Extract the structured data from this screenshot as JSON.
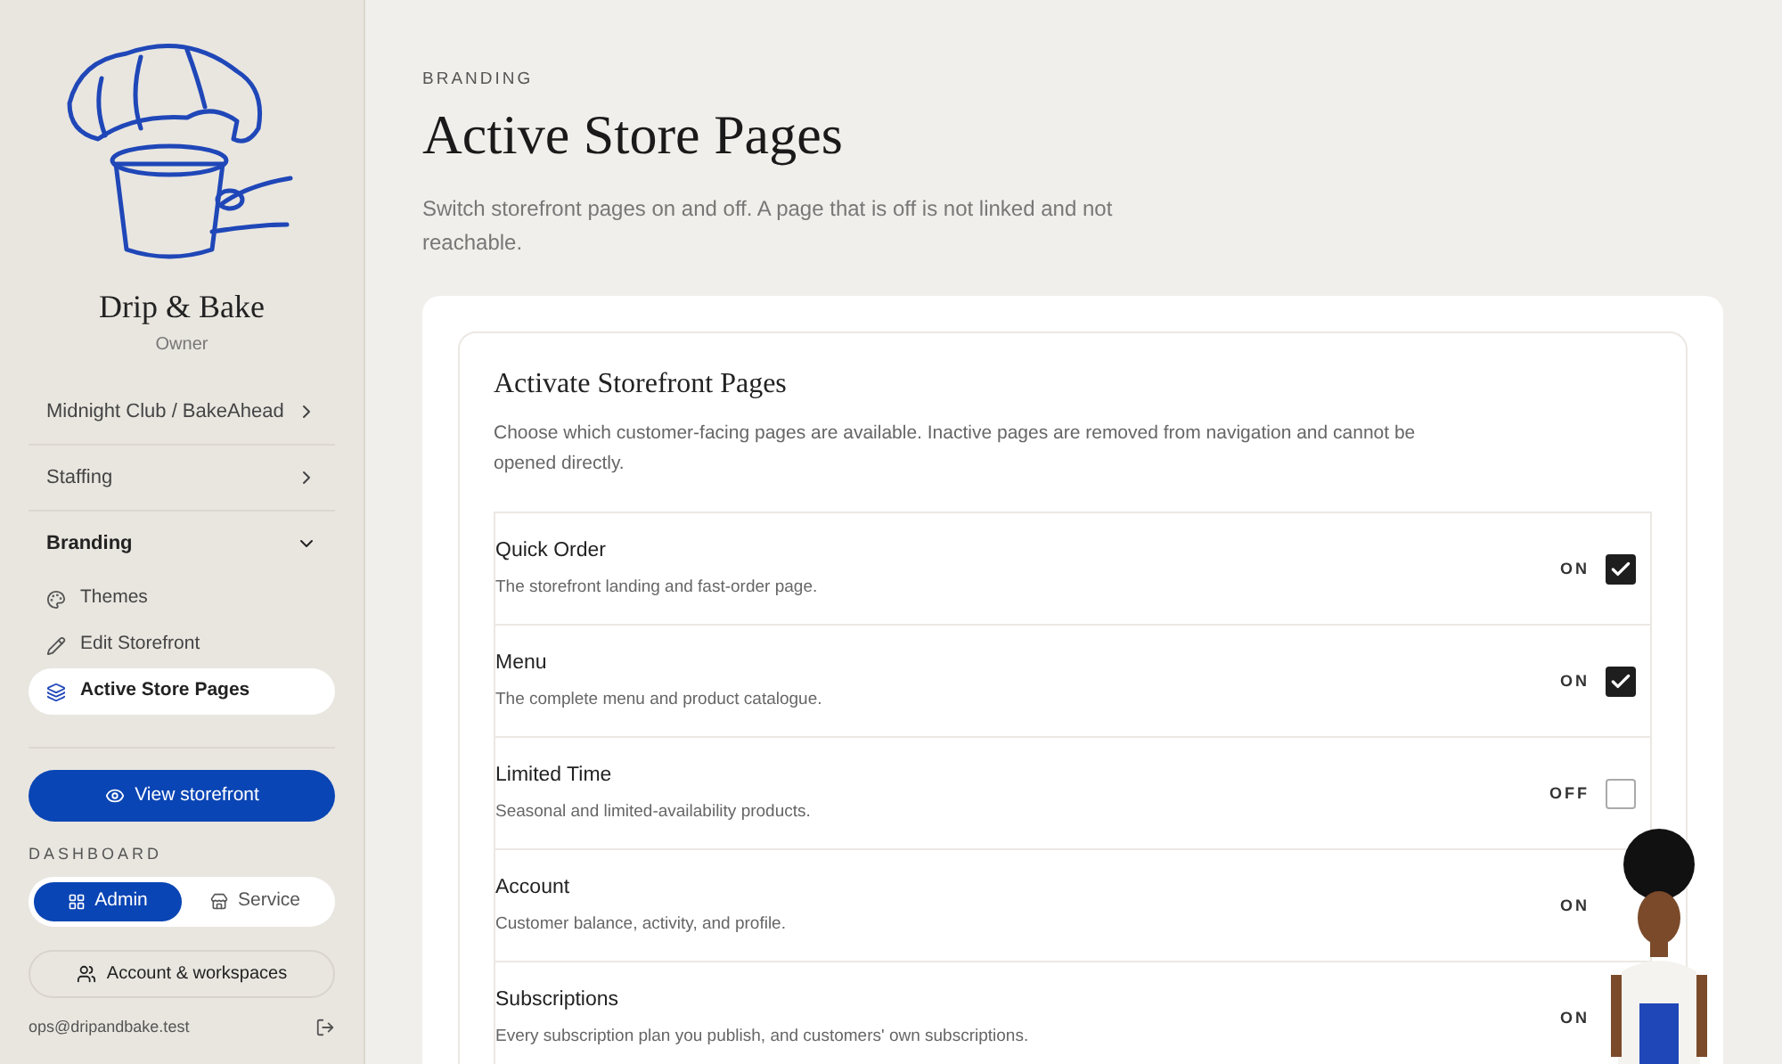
{
  "sidebar": {
    "brand": "Drip & Bake",
    "role": "Owner",
    "nav": [
      {
        "label": "Midnight Club / BakeAhead",
        "expanded": false
      },
      {
        "label": "Staffing",
        "expanded": false
      },
      {
        "label": "Branding",
        "expanded": true,
        "children": [
          {
            "label": "Themes",
            "selected": false
          },
          {
            "label": "Edit Storefront",
            "selected": false
          },
          {
            "label": "Active Store Pages",
            "selected": true
          }
        ]
      }
    ],
    "view_button": "View storefront",
    "dashboard_label": "DASHBOARD",
    "dashboard_tabs": [
      {
        "label": "Admin",
        "selected": true
      },
      {
        "label": "Service",
        "selected": false
      }
    ],
    "account_button": "Account & workspaces",
    "email": "ops@dripandbake.test"
  },
  "main": {
    "eyebrow": "BRANDING",
    "title": "Active Store Pages",
    "subtitle": "Switch storefront pages on and off. A page that is off is not linked and not reachable.",
    "card": {
      "title": "Activate Storefront Pages",
      "description": "Choose which customer-facing pages are available. Inactive pages are removed from navigation and cannot be opened directly.",
      "pages": [
        {
          "name": "Quick Order",
          "description": "The storefront landing and fast-order page.",
          "status": "ON",
          "checked": true
        },
        {
          "name": "Menu",
          "description": "The complete menu and product catalogue.",
          "status": "ON",
          "checked": true
        },
        {
          "name": "Limited Time",
          "description": "Seasonal and limited-availability products.",
          "status": "OFF",
          "checked": false
        },
        {
          "name": "Account",
          "description": "Customer balance, activity, and profile.",
          "status": "ON"
        },
        {
          "name": "Subscriptions",
          "description": "Every subscription plan you publish, and customers' own subscriptions.",
          "status": "ON"
        }
      ]
    }
  }
}
